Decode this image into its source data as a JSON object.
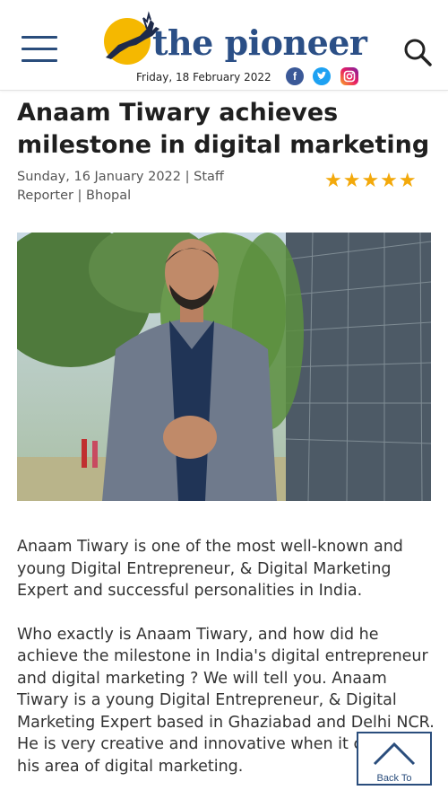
{
  "header": {
    "logo_text": "the pioneer",
    "date": "Friday, 18 February 2022",
    "social": {
      "facebook": "f",
      "twitter": "t",
      "instagram": "ig"
    },
    "brand_color": "#2b4f86",
    "logo_accent": "#f5b800"
  },
  "article": {
    "title": "Anaam Tiwary achieves milestone in digital marketing",
    "byline": "Sunday, 16 January 2022 | Staff Reporter | Bhopal",
    "rating": "★★★★★",
    "image_icon": "photo-portrait",
    "paragraphs": [
      "Anaam Tiwary is one of the most well-known and young Digital Entrepreneur, & Digital Marketing Expert and successful personalities in India.",
      "Who exactly is Anaam Tiwary, and how did he achieve the milestone in India's digital entrepreneur and digital marketing ? We will tell you. Anaam Tiwary is a young Digital Entrepreneur, & Digital Marketing Expert based in Ghaziabad and Delhi NCR. He is very creative and innovative when it comes to his area of digital marketing."
    ]
  },
  "back_to_top": {
    "label": "Back To"
  }
}
